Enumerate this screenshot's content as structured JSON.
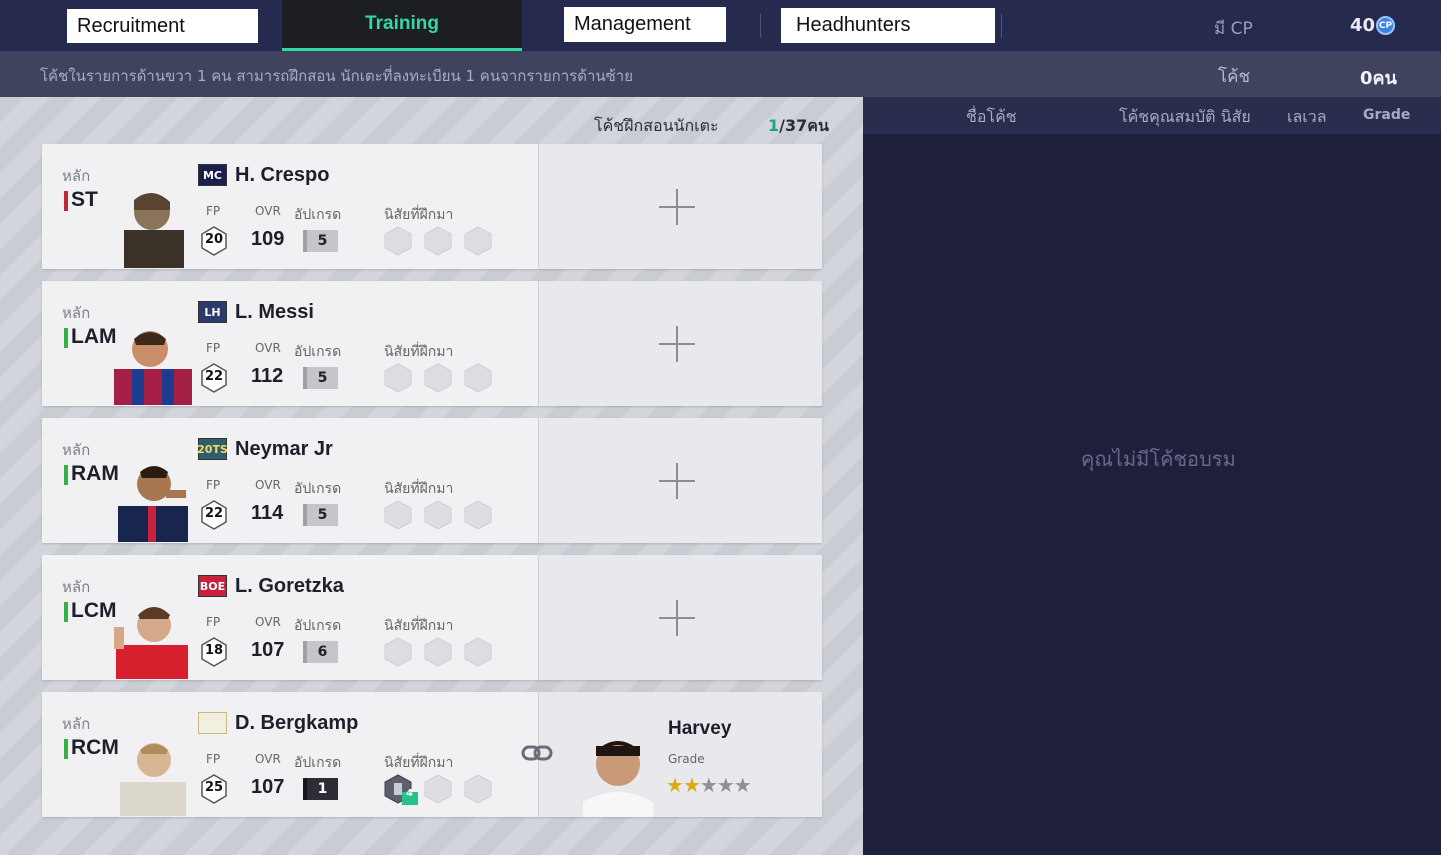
{
  "nav": {
    "tabs": [
      {
        "label": "Recruitment"
      },
      {
        "label": "Training"
      },
      {
        "label": "Management"
      },
      {
        "label": "Headhunters"
      }
    ],
    "cp_label": "มี CP",
    "cp_value": "40",
    "cp_icon_text": "CP"
  },
  "infobar": {
    "text": "โค้ชในรายการด้านขวา 1 คน สามารถฝึกสอน นักเตะที่ลงทะเบียน 1 คนจากรายการด้านซ้าย",
    "coach_label": "โค้ช",
    "coach_count": "0คน"
  },
  "left": {
    "header_label": "โค้ชฝึกสอนนักเตะ",
    "header_count_current": "1",
    "header_count_total": "/37คน",
    "labels": {
      "main": "หลัก",
      "fp": "FP",
      "ovr": "OVR",
      "upgrade": "อัปเกรด",
      "trait": "นิสัยที่ฝึกมา"
    },
    "players": [
      {
        "position": "ST",
        "pos_color": "#c0273a",
        "season": "MC",
        "name": "H. Crespo",
        "fp": "20",
        "ovr": "109",
        "upgrade": "5"
      },
      {
        "position": "LAM",
        "pos_color": "#34b04a",
        "season": "LH",
        "name": "L. Messi",
        "fp": "22",
        "ovr": "112",
        "upgrade": "5"
      },
      {
        "position": "RAM",
        "pos_color": "#34b04a",
        "season": "20TS",
        "name": "Neymar Jr",
        "fp": "22",
        "ovr": "114",
        "upgrade": "5"
      },
      {
        "position": "LCM",
        "pos_color": "#34b04a",
        "season": "BOE",
        "name": "L. Goretzka",
        "fp": "18",
        "ovr": "107",
        "upgrade": "6"
      },
      {
        "position": "RCM",
        "pos_color": "#34b04a",
        "season": "",
        "name": "D. Bergkamp",
        "fp": "25",
        "ovr": "107",
        "upgrade": "1",
        "trait_level": "4"
      }
    ],
    "assigned_coach": {
      "name": "Harvey",
      "grade_label": "Grade",
      "grade_stars": 2,
      "grade_max": 5
    }
  },
  "right": {
    "columns": [
      "ชื่อโค้ช",
      "โค้ชคุณสมบัติ นิสัย",
      "เลเวล",
      "Grade"
    ],
    "empty_message": "คุณไม่มีโค้ชอบรม"
  }
}
